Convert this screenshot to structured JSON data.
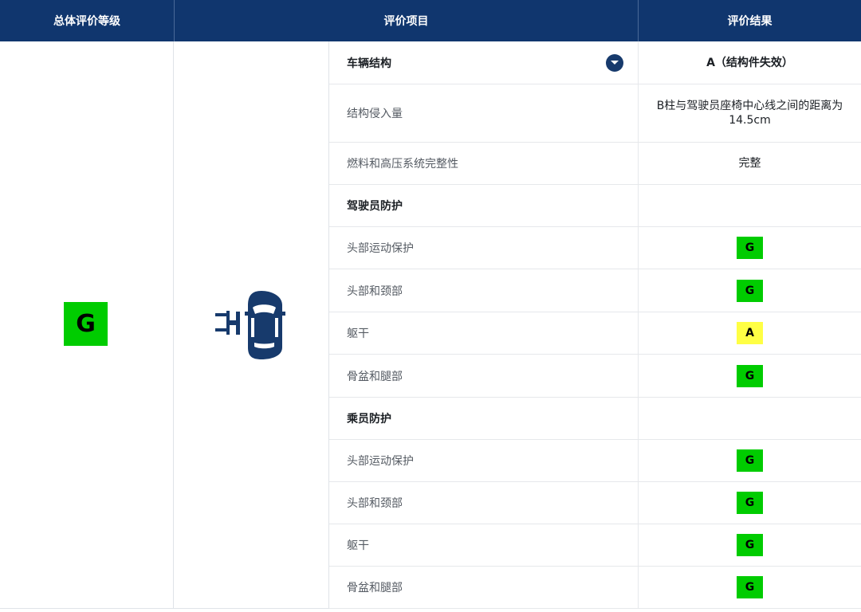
{
  "colors": {
    "header_bg": "#10366e",
    "rating_G": "#00cc00",
    "rating_A": "#ffff44",
    "icon_blue": "#173a6c"
  },
  "header": {
    "overall": "总体评价等级",
    "items": "评价项目",
    "results": "评价结果"
  },
  "overall_rating": "G",
  "test_icon": "side-pole-impact-car-icon",
  "rows": [
    {
      "label": "车辆结构",
      "section": true,
      "result": "A（结构件失效）",
      "result_type": "text",
      "has_dropdown": true,
      "dropdown_icon": "chevron-down-icon"
    },
    {
      "label": "结构侵入量",
      "section": false,
      "result": "B柱与驾驶员座椅中心线之间的距离为14.5cm",
      "result_type": "text"
    },
    {
      "label": "燃料和高压系统完整性",
      "section": false,
      "result": "完整",
      "result_type": "text"
    },
    {
      "label": "驾驶员防护",
      "section": true,
      "result": "",
      "result_type": "none"
    },
    {
      "label": "头部运动保护",
      "section": false,
      "result": "G",
      "result_type": "badge"
    },
    {
      "label": "头部和颈部",
      "section": false,
      "result": "G",
      "result_type": "badge"
    },
    {
      "label": "躯干",
      "section": false,
      "result": "A",
      "result_type": "badge"
    },
    {
      "label": "骨盆和腿部",
      "section": false,
      "result": "G",
      "result_type": "badge"
    },
    {
      "label": "乘员防护",
      "section": true,
      "result": "",
      "result_type": "none"
    },
    {
      "label": "头部运动保护",
      "section": false,
      "result": "G",
      "result_type": "badge"
    },
    {
      "label": "头部和颈部",
      "section": false,
      "result": "G",
      "result_type": "badge"
    },
    {
      "label": "躯干",
      "section": false,
      "result": "G",
      "result_type": "badge"
    },
    {
      "label": "骨盆和腿部",
      "section": false,
      "result": "G",
      "result_type": "badge"
    }
  ]
}
